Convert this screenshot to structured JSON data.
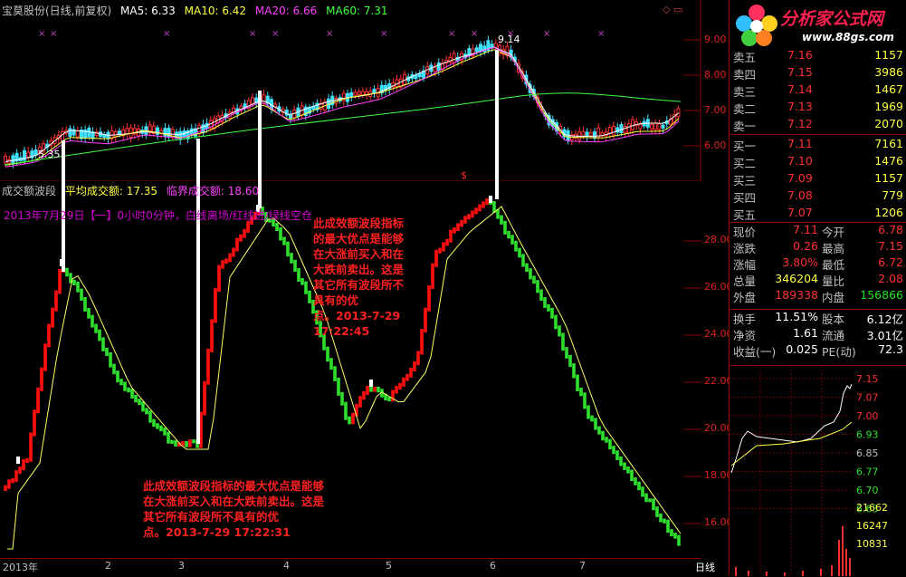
{
  "top_bar": {
    "title": "宝莫股份(日线,前复权)",
    "ma5": "MA5: 6.33",
    "ma10": "MA10: 6.42",
    "ma20": "MA20: 6.66",
    "ma60": "MA60: 7.31",
    "colors": {
      "ma5": "#ffffff",
      "ma10": "#ffff40",
      "ma20": "#ff40ff",
      "ma60": "#40ff40"
    }
  },
  "kline": {
    "high_label": "9.14",
    "low_label": "5.35",
    "price_ticks": [
      "9.00",
      "8.00",
      "7.00",
      "6.00"
    ]
  },
  "indicator": {
    "name": "成交额波段",
    "avg_label": "平均成交额: 17.35",
    "threshold_label": "临界成交额: 18.60",
    "status_line": "2013年7月29日【一】0小时0分钟，白线离场/红线进/绿线空仓",
    "y_ticks": [
      "28.00",
      "26.00",
      "24.00",
      "22.00",
      "20.00",
      "18.00",
      "16.00"
    ]
  },
  "annotations": {
    "note_top": [
      "此成效额波段指标",
      "的最大优点是能够",
      "在大涨前买入和在",
      "大跌前卖出。这是",
      "其它所有波段所不",
      "具有的优",
      "点。2013-7-29",
      "17:22:45"
    ],
    "note_bottom": [
      "此成效额波段指标的最大优点是能够",
      "在大涨前买入和在大跌前卖出。这是",
      "其它所有波段所不具有的优",
      "点。2013-7-29  17:22:31"
    ]
  },
  "x_axis": {
    "labels": [
      "2013年",
      "2",
      "3",
      "4",
      "5",
      "6",
      "7"
    ],
    "period_label": "日线"
  },
  "logo": {
    "text": "分析家公式网",
    "url_text": "www.88gs.com"
  },
  "order_book": {
    "asks": [
      {
        "name": "卖五",
        "price": "7.16",
        "vol": "1157"
      },
      {
        "name": "卖四",
        "price": "7.15",
        "vol": "3986"
      },
      {
        "name": "卖三",
        "price": "7.14",
        "vol": "1467"
      },
      {
        "name": "卖二",
        "price": "7.13",
        "vol": "1969"
      },
      {
        "name": "卖一",
        "price": "7.12",
        "vol": "2070"
      }
    ],
    "bids": [
      {
        "name": "买一",
        "price": "7.11",
        "vol": "7161"
      },
      {
        "name": "买二",
        "price": "7.10",
        "vol": "1476"
      },
      {
        "name": "买三",
        "price": "7.09",
        "vol": "1157"
      },
      {
        "name": "买四",
        "price": "7.08",
        "vol": "779"
      },
      {
        "name": "买五",
        "price": "7.07",
        "vol": "1206"
      }
    ]
  },
  "stats": [
    {
      "l1": "现价",
      "v1": "7.11",
      "c1": "red",
      "l2": "今开",
      "v2": "6.78",
      "c2": "red"
    },
    {
      "l1": "涨跌",
      "v1": "0.26",
      "c1": "red",
      "l2": "最高",
      "v2": "7.15",
      "c2": "red"
    },
    {
      "l1": "涨幅",
      "v1": "3.80%",
      "c1": "red",
      "l2": "最低",
      "v2": "6.72",
      "c2": "red"
    },
    {
      "l1": "总量",
      "v1": "346204",
      "c1": "yellow",
      "l2": "量比",
      "v2": "2.08",
      "c2": "red"
    },
    {
      "l1": "外盘",
      "v1": "189338",
      "c1": "red",
      "l2": "内盘",
      "v2": "156866",
      "c2": "green"
    },
    {
      "l1": "换手",
      "v1": "11.51%",
      "c1": "white",
      "l2": "股本",
      "v2": "6.12亿",
      "c2": "white"
    },
    {
      "l1": "净资",
      "v1": "1.61",
      "c1": "white",
      "l2": "流通",
      "v2": "3.01亿",
      "c2": "white"
    },
    {
      "l1": "收益(一)",
      "v1": "0.025",
      "c1": "white",
      "l2": "PE(动)",
      "v2": "72.3",
      "c2": "white"
    }
  ],
  "intraday": {
    "price_ticks": [
      "7.15",
      "7.07",
      "7.00",
      "6.93",
      "6.85",
      "6.77",
      "6.70",
      "6.63"
    ],
    "vol_ticks": [
      "21662",
      "16247",
      "10831"
    ]
  }
}
